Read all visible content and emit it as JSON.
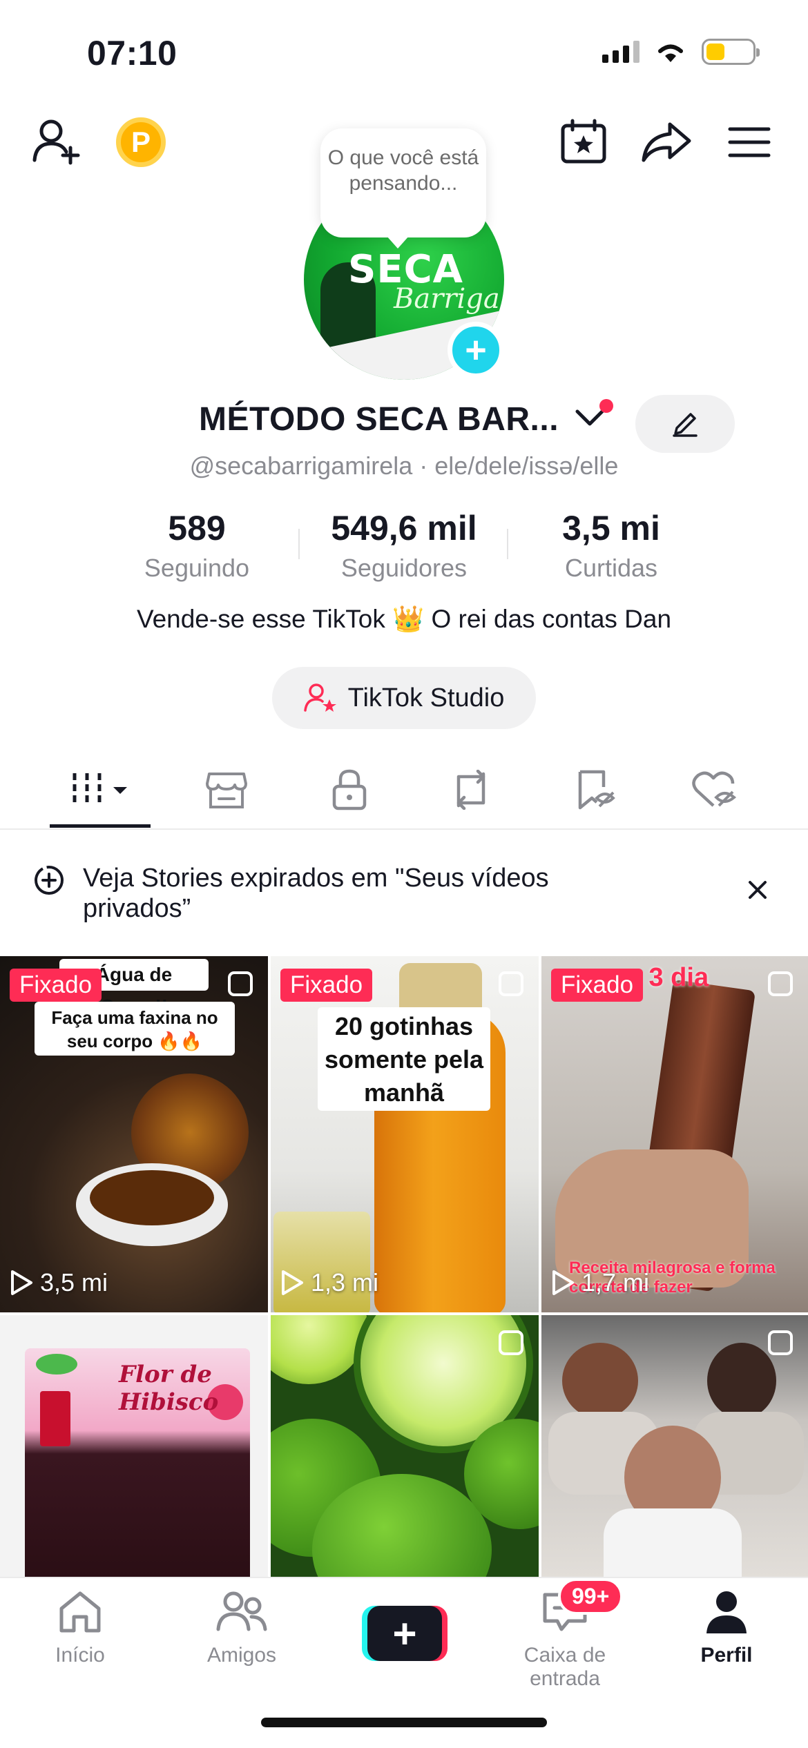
{
  "status_bar": {
    "time": "07:10"
  },
  "bubble": {
    "text": "O que você está pensando..."
  },
  "avatar": {
    "logo_line1": "SECA",
    "logo_line2": "Barriga"
  },
  "profile": {
    "name": "MÉTODO SECA BAR...",
    "handle": "@secabarrigamirela · ele/dele/issə/elle",
    "bio": "Vende-se esse TikTok 👑 O rei das contas Dan"
  },
  "stats": [
    {
      "value": "589",
      "label": "Seguindo"
    },
    {
      "value": "549,6 mil",
      "label": "Seguidores"
    },
    {
      "value": "3,5 mi",
      "label": "Curtidas"
    }
  ],
  "studio_button": {
    "label": "TikTok Studio"
  },
  "stories_banner": {
    "text": "Veja Stories expirados em \"Seus vídeos privados”"
  },
  "videos": [
    {
      "pinned_label": "Fixado",
      "views": "3,5 mi",
      "caption_top": "Água de Cravo!!",
      "caption": "Faça uma faxina no seu corpo 🔥🔥"
    },
    {
      "pinned_label": "Fixado",
      "views": "1,3 mi",
      "caption": "20 gotinhas somente pela manhã"
    },
    {
      "pinned_label": "Fixado",
      "views": "1,7 mi",
      "caption": "em 3 dia",
      "caption_bottom": "Receita milagrosa e forma correta de fazer"
    },
    {
      "caption": "Flor de Hibisco"
    },
    {
      "caption": ""
    },
    {
      "caption": ""
    }
  ],
  "bottom_nav": {
    "items": [
      {
        "label": "Início",
        "icon": "home-icon"
      },
      {
        "label": "Amigos",
        "icon": "friends-icon"
      },
      {
        "label": "",
        "icon": "plus-icon"
      },
      {
        "label": "Caixa de entrada",
        "icon": "inbox-icon",
        "badge": "99+"
      },
      {
        "label": "Perfil",
        "icon": "profile-icon"
      }
    ]
  },
  "colors": {
    "accent": "#fe2c55",
    "cyan": "#25f4ee",
    "avatar_green": "#12a830"
  }
}
